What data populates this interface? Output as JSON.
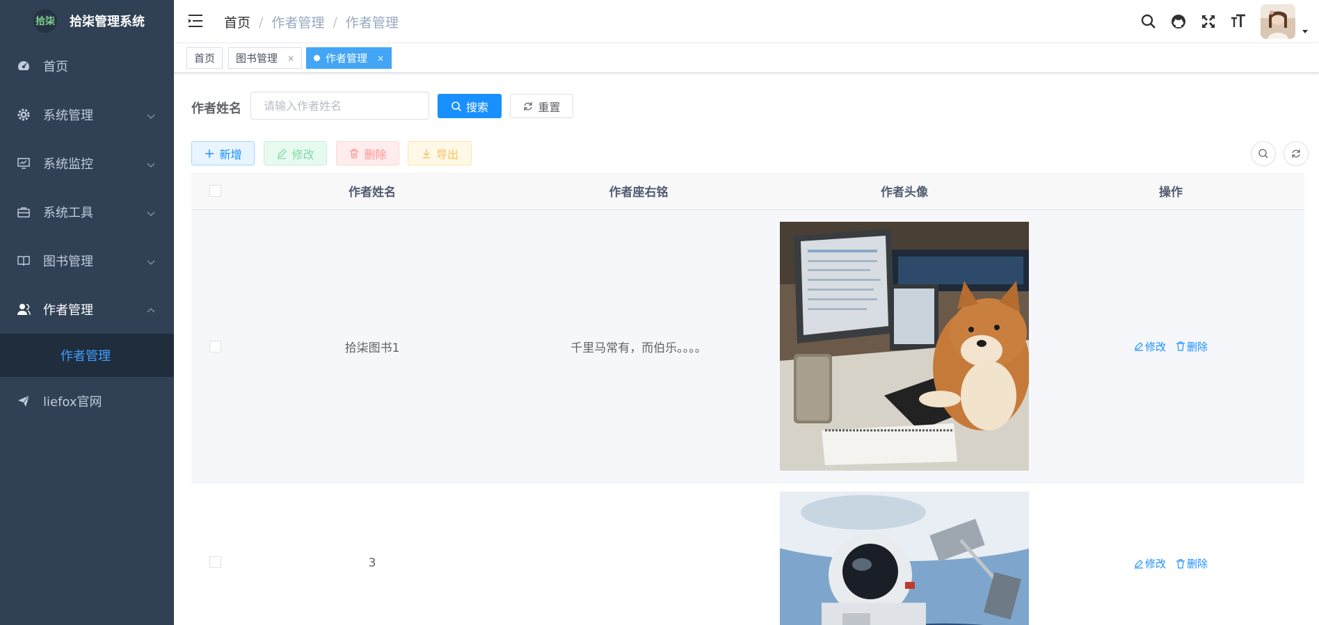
{
  "sidebar": {
    "logo_mark": "拾柒",
    "title": "拾柒管理系统",
    "items": [
      {
        "label": "首页"
      },
      {
        "label": "系统管理"
      },
      {
        "label": "系统监控"
      },
      {
        "label": "系统工具"
      },
      {
        "label": "图书管理"
      },
      {
        "label": "作者管理"
      },
      {
        "label": "作者管理"
      },
      {
        "label": "liefox官网"
      }
    ]
  },
  "breadcrumb": [
    "首页",
    "/",
    "作者管理",
    "/",
    "作者管理"
  ],
  "tags": [
    {
      "label": "首页",
      "close": ""
    },
    {
      "label": "图书管理",
      "close": "×"
    },
    {
      "label": "作者管理",
      "close": "×"
    }
  ],
  "search": {
    "label": "作者姓名",
    "placeholder": "请输入作者姓名",
    "value": "",
    "search_button": "搜索",
    "reset_button": "重置"
  },
  "toolbar": {
    "add": "新增",
    "edit": "修改",
    "delete": "删除",
    "export": "导出"
  },
  "table": {
    "columns": [
      "作者姓名",
      "作者座右铭",
      "作者头像",
      "操作"
    ],
    "rows": [
      {
        "name": "拾柒图书1",
        "motto": "千里马常有，而伯乐。。。。",
        "avatar": "shiba-at-desk-image",
        "edit": "修改",
        "delete": "删除"
      },
      {
        "name": "3",
        "motto": "",
        "avatar": "astronaut-in-space-image",
        "edit": "修改",
        "delete": "删除"
      }
    ]
  },
  "colors": {
    "sidebar_bg": "#304156",
    "submenu_bg": "#1f2d3d",
    "accent": "#1890ff",
    "active_tag": "#42a5f5"
  },
  "icons": [
    "dashboard-icon",
    "gear-icon",
    "monitor-icon",
    "toolbox-icon",
    "book-icon",
    "user-icon",
    "send-icon",
    "hamburger-icon",
    "search-icon",
    "github-icon",
    "fullscreen-icon",
    "font-size-icon",
    "refresh-icon"
  ]
}
